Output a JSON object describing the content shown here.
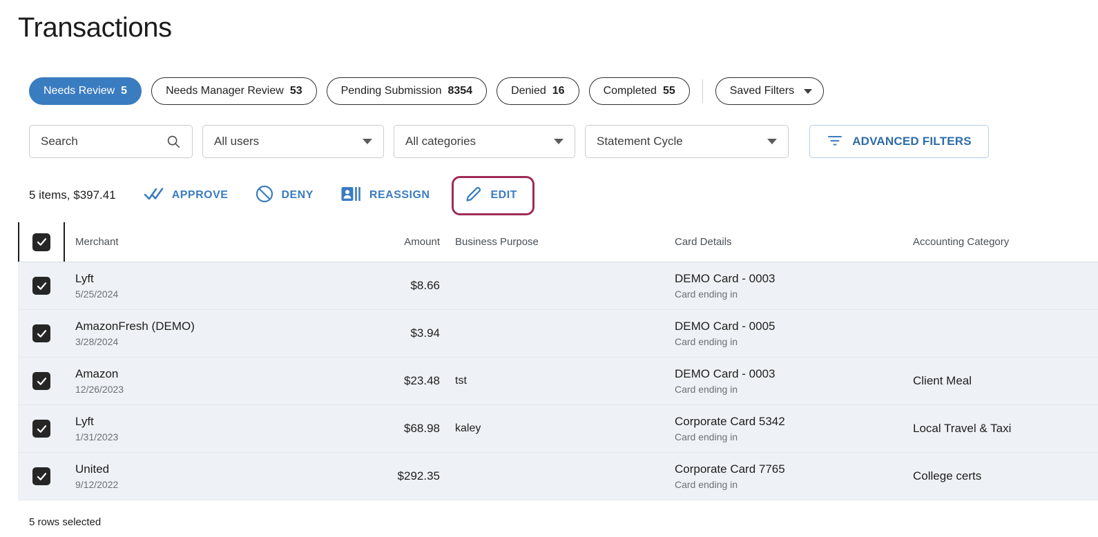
{
  "header": {
    "title": "Transactions"
  },
  "status_tabs": [
    {
      "label": "Needs Review",
      "count": "5",
      "active": true
    },
    {
      "label": "Needs Manager Review",
      "count": "53",
      "active": false
    },
    {
      "label": "Pending Submission",
      "count": "8354",
      "active": false
    },
    {
      "label": "Denied",
      "count": "16",
      "active": false
    },
    {
      "label": "Completed",
      "count": "55",
      "active": false
    }
  ],
  "saved_filters": {
    "label": "Saved Filters",
    "icon": "chevron-down-icon"
  },
  "filters": {
    "search": {
      "placeholder": "Search",
      "value": "",
      "icon": "search-icon"
    },
    "users": {
      "value": "All users",
      "icon": "chevron-down-icon"
    },
    "categories": {
      "value": "All categories",
      "icon": "chevron-down-icon"
    },
    "statement_cycle": {
      "value": "Statement Cycle",
      "icon": "chevron-down-icon"
    },
    "advanced": {
      "label": "ADVANCED FILTERS",
      "icon": "filter-icon"
    }
  },
  "bulk_actions": {
    "summary": "5 items, $397.41",
    "items": [
      {
        "label": "APPROVE",
        "icon": "double-check-icon",
        "highlighted": false
      },
      {
        "label": "DENY",
        "icon": "deny-circle-slash-icon",
        "highlighted": false
      },
      {
        "label": "REASSIGN",
        "icon": "id-badge-icon",
        "highlighted": false
      },
      {
        "label": "EDIT",
        "icon": "pencil-icon",
        "highlighted": true
      }
    ],
    "highlight_color": "#9e2b56"
  },
  "table": {
    "columns": {
      "merchant": "Merchant",
      "amount": "Amount",
      "purpose": "Business Purpose",
      "card": "Card Details",
      "category": "Accounting Category"
    },
    "select_all_checked": true,
    "rows": [
      {
        "checked": true,
        "merchant": "Lyft",
        "date": "5/25/2024",
        "amount": "$8.66",
        "purpose": "",
        "card_name": "DEMO Card - 0003",
        "card_sub": "Card ending in",
        "category": ""
      },
      {
        "checked": true,
        "merchant": "AmazonFresh (DEMO)",
        "date": "3/28/2024",
        "amount": "$3.94",
        "purpose": "",
        "card_name": "DEMO Card - 0005",
        "card_sub": "Card ending in",
        "category": ""
      },
      {
        "checked": true,
        "merchant": "Amazon",
        "date": "12/26/2023",
        "amount": "$23.48",
        "purpose": "tst",
        "card_name": "DEMO Card - 0003",
        "card_sub": "Card ending in",
        "category": "Client Meal"
      },
      {
        "checked": true,
        "merchant": "Lyft",
        "date": "1/31/2023",
        "amount": "$68.98",
        "purpose": "kaley",
        "card_name": "Corporate Card 5342",
        "card_sub": "Card ending in",
        "category": "Local Travel & Taxi"
      },
      {
        "checked": true,
        "merchant": "United",
        "date": "9/12/2022",
        "amount": "$292.35",
        "purpose": "",
        "card_name": "Corporate Card 7765",
        "card_sub": "Card ending in",
        "category": "College certs"
      }
    ]
  },
  "footer": {
    "rows_selected": "5 rows selected"
  },
  "colors": {
    "accent_blue": "#3a7cc0",
    "link_blue": "#2d6ca8",
    "row_selected_bg": "#eef2f6",
    "highlight_maroon": "#9e2b56",
    "checkbox_dark": "#262626"
  }
}
